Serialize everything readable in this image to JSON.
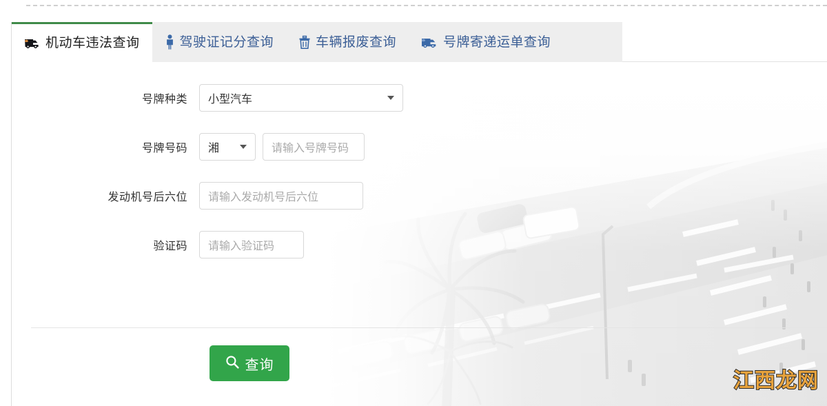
{
  "page": {
    "title": "机动车违法查询",
    "accent_green": "#3f8b49",
    "button_green": "#32a54a",
    "tab_link_blue": "#3c5f96",
    "tabstrip_bg": "#eeeeee"
  },
  "tabs": [
    {
      "id": "vehicle-violation",
      "label": "机动车违法查询",
      "icon": "truck-icon",
      "active": true
    },
    {
      "id": "license-points",
      "label": "驾驶证记分查询",
      "icon": "person-icon",
      "active": false
    },
    {
      "id": "vehicle-scrap",
      "label": "车辆报废查询",
      "icon": "trash-icon",
      "active": false
    },
    {
      "id": "plate-shipping",
      "label": "号牌寄递运单查询",
      "icon": "delivery-truck-icon",
      "active": false
    }
  ],
  "form": {
    "plate_type": {
      "label": "号牌种类",
      "value": "小型汽车",
      "caret": "chevron-down-icon"
    },
    "plate_number": {
      "label": "号牌号码",
      "province_value": "湘",
      "province_caret": "chevron-down-icon",
      "placeholder": "请输入号牌号码",
      "value": ""
    },
    "engine_number": {
      "label": "发动机号后六位",
      "placeholder": "请输入发动机号后六位",
      "value": ""
    },
    "captcha": {
      "label": "验证码",
      "placeholder": "请输入验证码",
      "value": ""
    },
    "submit": {
      "label": "查询",
      "icon": "search-icon"
    }
  },
  "watermark": {
    "text": "江西龙网",
    "color": "#e8a33d"
  }
}
